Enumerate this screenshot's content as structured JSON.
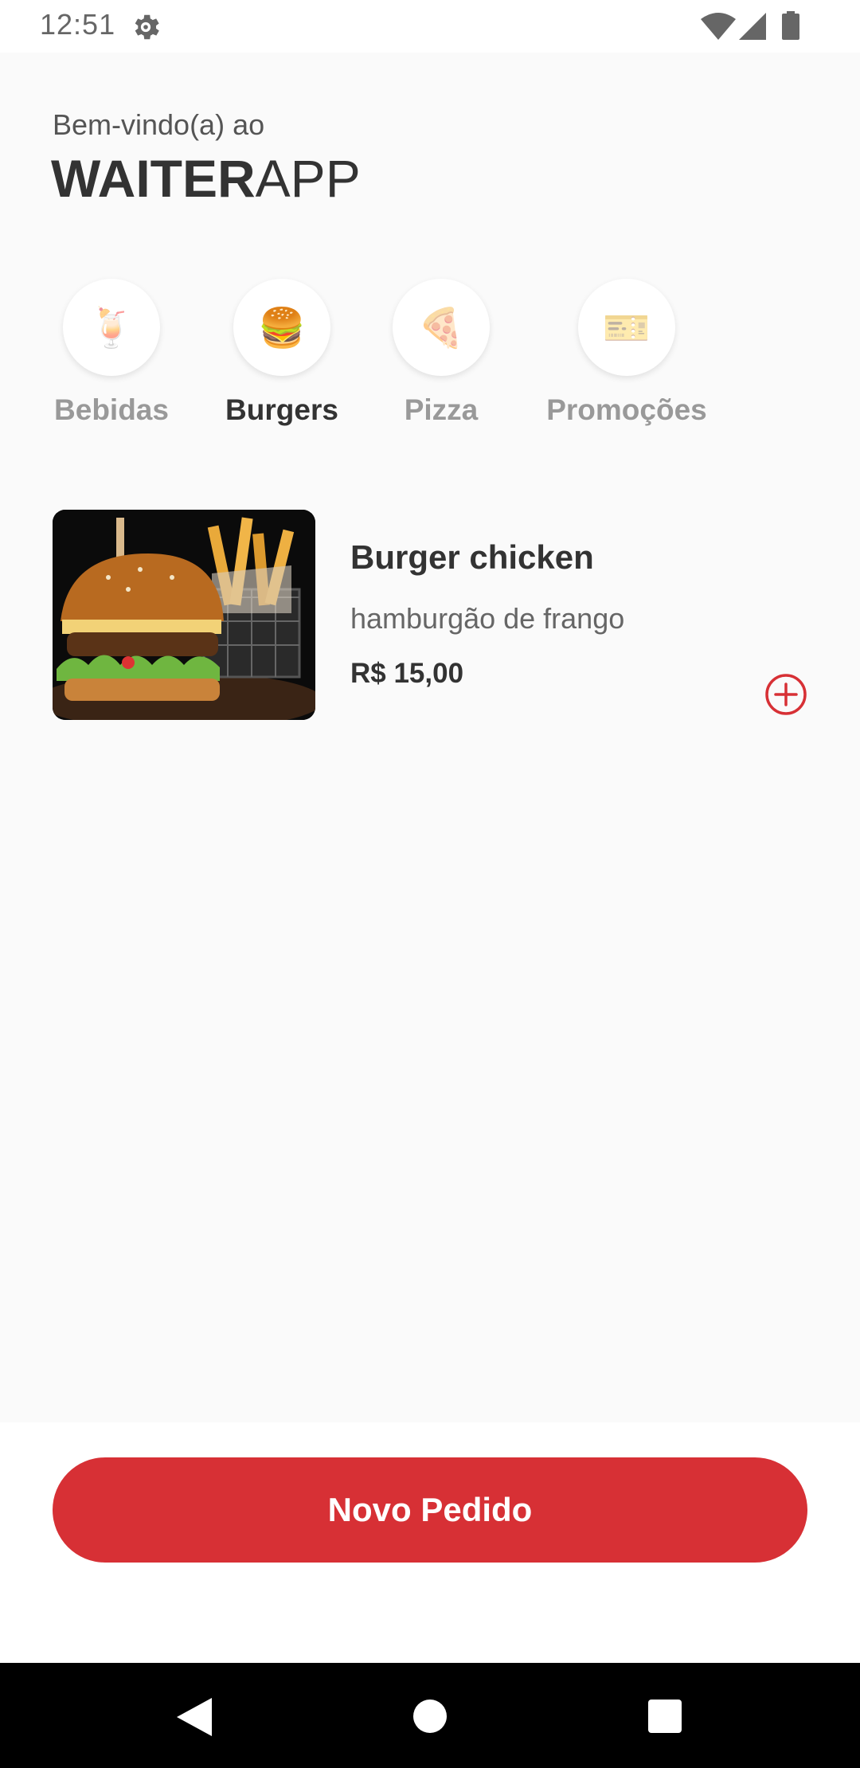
{
  "status_bar": {
    "time": "12:51",
    "icons": [
      "settings-gear-icon",
      "wifi-icon",
      "cellular-signal-icon",
      "battery-icon"
    ]
  },
  "header": {
    "greeting": "Bem-vindo(a) ao",
    "brand_bold": "WAITER",
    "brand_light": "APP"
  },
  "categories": [
    {
      "label": "Bebidas",
      "icon": "🍹",
      "icon_name": "drink-icon",
      "selected": false
    },
    {
      "label": "Burgers",
      "icon": "🍔",
      "icon_name": "burger-icon",
      "selected": true
    },
    {
      "label": "Pizza",
      "icon": "🍕",
      "icon_name": "pizza-icon",
      "selected": false
    },
    {
      "label": "Promoções",
      "icon": "🎫",
      "icon_name": "ticket-icon",
      "selected": false
    }
  ],
  "products": [
    {
      "name": "Burger chicken",
      "description": "hamburgão de frango",
      "price": "R$ 15,00"
    }
  ],
  "footer": {
    "new_order_label": "Novo Pedido"
  },
  "colors": {
    "accent": "#d73035",
    "background": "#fafafa",
    "text_primary": "#333333",
    "text_muted": "#999999"
  },
  "nav_bar": {
    "icons": [
      "back-icon",
      "home-icon",
      "recents-icon"
    ]
  }
}
